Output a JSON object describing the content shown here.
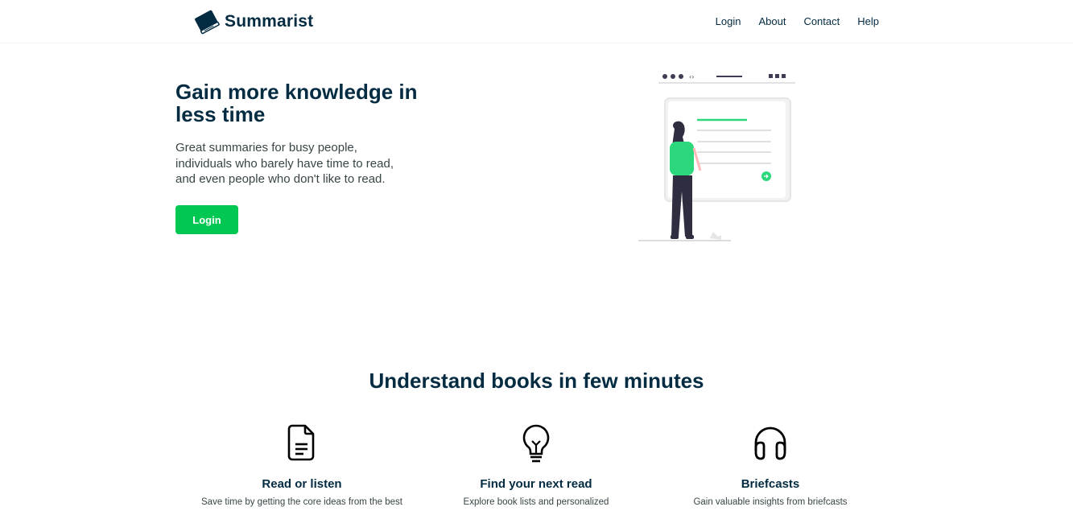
{
  "brand": {
    "name": "Summarist",
    "icon": "book-icon"
  },
  "nav": {
    "links": [
      "Login",
      "About",
      "Contact",
      "Help"
    ]
  },
  "hero": {
    "title": "Gain more knowledge in less time",
    "subtitle_lines": [
      "Great summaries for busy people,",
      "individuals who barely have time to read,",
      "and even people who don't like to read."
    ],
    "button_label": "Login"
  },
  "features": {
    "title": "Understand books in few minutes",
    "items": [
      {
        "icon": "document-icon",
        "title": "Read or listen",
        "desc": "Save time by getting the core ideas from the best"
      },
      {
        "icon": "lightbulb-icon",
        "title": "Find your next read",
        "desc": "Explore book lists and personalized"
      },
      {
        "icon": "headphones-icon",
        "title": "Briefcasts",
        "desc": "Gain valuable insights from briefcasts"
      }
    ]
  },
  "colors": {
    "primary_text": "#032b41",
    "accent_green": "#00c853"
  }
}
